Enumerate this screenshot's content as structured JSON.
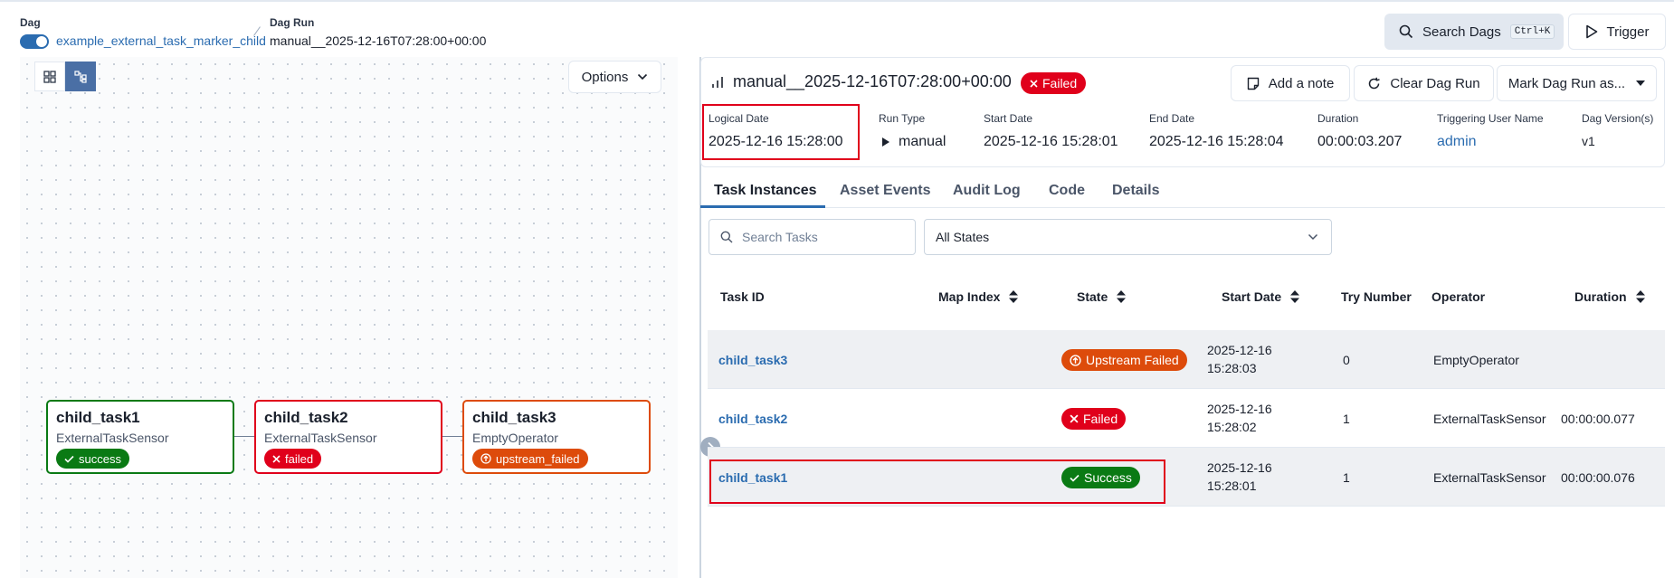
{
  "breadcrumb": {
    "dag_label": "Dag",
    "dag_id": "example_external_task_marker_child",
    "run_label": "Dag Run",
    "run_id": "manual__2025-12-16T07:28:00+00:00"
  },
  "top_actions": {
    "search_label": "Search Dags",
    "search_shortcut": "Ctrl+K",
    "trigger_label": "Trigger"
  },
  "graph": {
    "options_label": "Options",
    "nodes": [
      {
        "name": "child_task1",
        "operator": "ExternalTaskSensor",
        "state": "success",
        "color": "#0a7a14"
      },
      {
        "name": "child_task2",
        "operator": "ExternalTaskSensor",
        "state": "failed",
        "color": "#e0001b"
      },
      {
        "name": "child_task3",
        "operator": "EmptyOperator",
        "state": "upstream_failed",
        "color": "#dd4b0b"
      }
    ]
  },
  "run": {
    "title": "manual__2025-12-16T07:28:00+00:00",
    "state": "Failed",
    "add_note_label": "Add a note",
    "clear_label": "Clear Dag Run",
    "mark_label": "Mark Dag Run as...",
    "meta": {
      "logical_date_label": "Logical Date",
      "logical_date": "2025-12-16 15:28:00",
      "run_type_label": "Run Type",
      "run_type": "manual",
      "start_date_label": "Start Date",
      "start_date": "2025-12-16 15:28:01",
      "end_date_label": "End Date",
      "end_date": "2025-12-16 15:28:04",
      "duration_label": "Duration",
      "duration": "00:00:03.207",
      "triggering_user_label": "Triggering User Name",
      "triggering_user": "admin",
      "dag_version_label": "Dag Version(s)",
      "dag_version": "v1"
    }
  },
  "tabs": [
    "Task Instances",
    "Asset Events",
    "Audit Log",
    "Code",
    "Details"
  ],
  "filters": {
    "search_placeholder": "Search Tasks",
    "state_selected": "All States"
  },
  "table": {
    "headers": {
      "task_id": "Task ID",
      "map_index": "Map Index",
      "state": "State",
      "start_date": "Start Date",
      "try_number": "Try Number",
      "operator": "Operator",
      "duration": "Duration"
    },
    "rows": [
      {
        "task_id": "child_task3",
        "state": "Upstream Failed",
        "state_color": "#dd4b0b",
        "start_date_1": "2025-12-16",
        "start_date_2": "15:28:03",
        "try_number": "0",
        "operator": "EmptyOperator",
        "duration": ""
      },
      {
        "task_id": "child_task2",
        "state": "Failed",
        "state_color": "#e0001b",
        "start_date_1": "2025-12-16",
        "start_date_2": "15:28:02",
        "try_number": "1",
        "operator": "ExternalTaskSensor",
        "duration": "00:00:00.077"
      },
      {
        "task_id": "child_task1",
        "state": "Success",
        "state_color": "#0a7a14",
        "start_date_1": "2025-12-16",
        "start_date_2": "15:28:01",
        "try_number": "1",
        "operator": "ExternalTaskSensor",
        "duration": "00:00:00.076"
      }
    ]
  }
}
